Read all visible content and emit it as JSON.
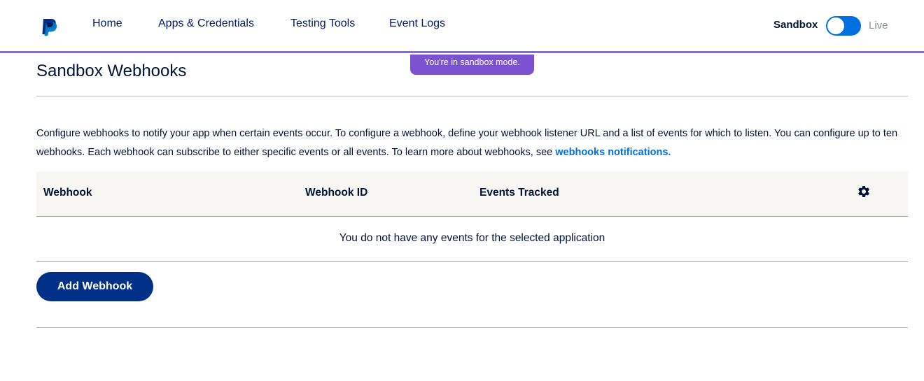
{
  "nav": {
    "logo_icon": "paypal-logo-icon",
    "items": [
      {
        "label": "Home"
      },
      {
        "label": "Apps & Credentials"
      },
      {
        "label": "Testing Tools"
      },
      {
        "label": "Event Logs"
      }
    ]
  },
  "environment": {
    "sandbox_label": "Sandbox",
    "live_label": "Live",
    "mode": "sandbox",
    "banner": "You're in sandbox mode."
  },
  "page": {
    "title": "Sandbox Webhooks",
    "description": "Configure webhooks to notify your app when certain events occur. To configure a webhook, define your webhook listener URL and a list of events for which to listen. You can configure up to ten webhooks. Each webhook can subscribe to either specific events or all events. To learn more about webhooks, see",
    "description_link": "webhooks notifications."
  },
  "table": {
    "columns": [
      "Webhook",
      "Webhook ID",
      "Events Tracked"
    ],
    "settings_icon": "gear-icon",
    "empty_message": "You do not have any events for the selected application"
  },
  "actions": {
    "add_webhook": "Add Webhook"
  },
  "colors": {
    "brand_navy": "#003087",
    "accent_blue": "#0070e0",
    "sandbox_purple": "#7b52cf"
  }
}
